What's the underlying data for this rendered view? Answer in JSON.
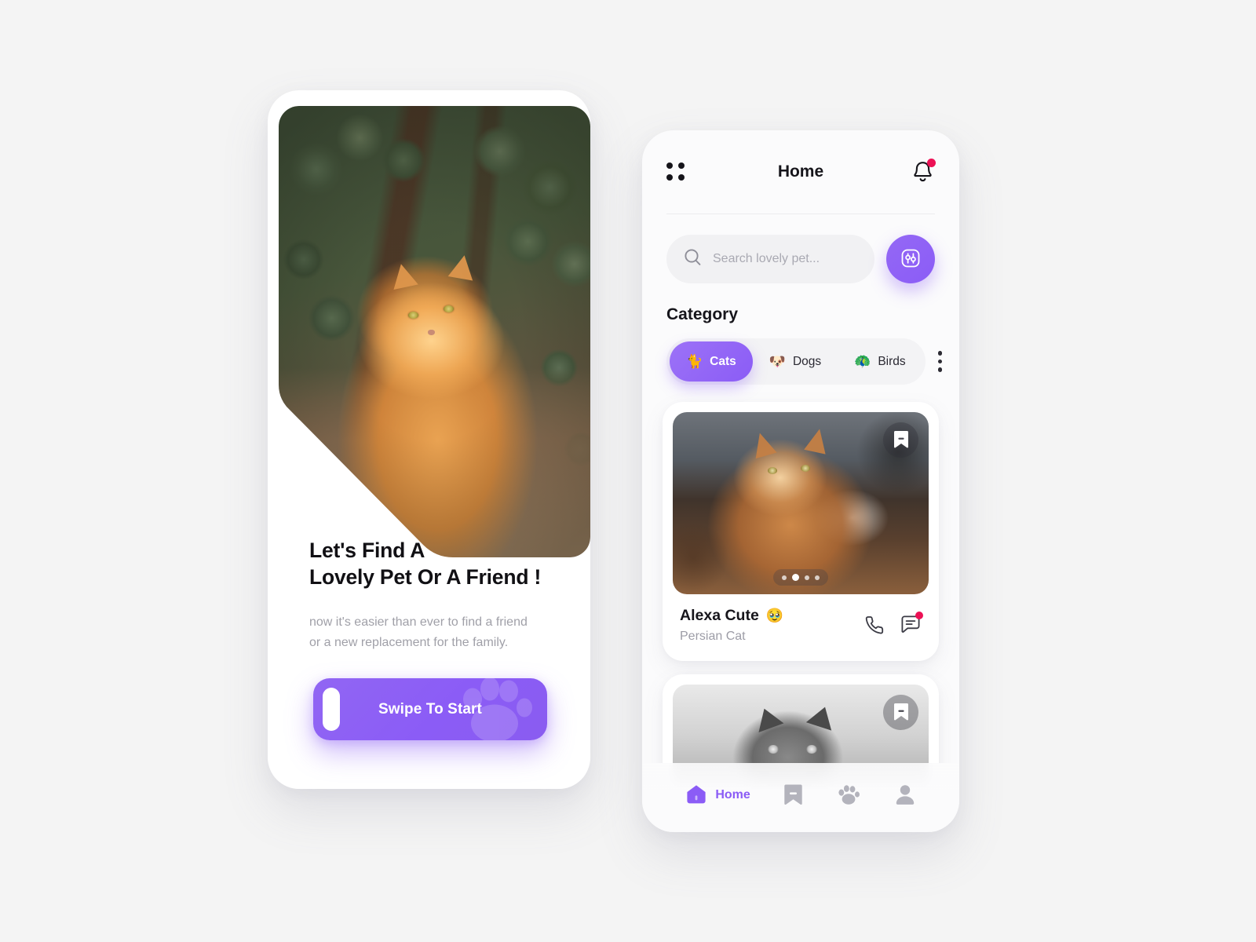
{
  "theme": {
    "accent": "#8b5cf6",
    "accent_light": "#9c72f7",
    "badge": "#ec1155",
    "background": "#f4f4f4",
    "text_dark": "#16151b",
    "text_muted": "#a0a0a8"
  },
  "onboarding": {
    "hero_image_alt": "ginger-long-haired-cat-in-garden",
    "title_line1": "Let's Find A",
    "title_line2": "Lovely Pet Or A Friend !",
    "subtitle_line1": "now it's easier than ever to find a friend",
    "subtitle_line2": "or a new replacement for the family.",
    "swipe_button": {
      "label": "Swipe To Start",
      "handle_icon": "swipe-handle",
      "watermark_icon": "paw-print-icon"
    }
  },
  "app": {
    "header": {
      "menu_icon": "grid-dots-icon",
      "title": "Home",
      "bell_icon": "bell-icon",
      "bell_has_badge": true
    },
    "search": {
      "icon": "search-icon",
      "value": "",
      "placeholder": "Search lovely pet...",
      "filter_icon": "sliders-icon"
    },
    "category": {
      "title": "Category",
      "more_icon": "kebab-menu-icon",
      "chips": [
        {
          "label": "Cats",
          "emoji": "🐈",
          "active": true
        },
        {
          "label": "Dogs",
          "emoji": "🐶",
          "active": false
        },
        {
          "label": "Birds",
          "emoji": "🦚",
          "active": false
        }
      ]
    },
    "cards": [
      {
        "image_alt": "maine-coon-ginger-cat",
        "bookmark_icon": "bookmark-icon",
        "carousel_dots": 4,
        "carousel_active_index": 1,
        "name": "Alexa Cute",
        "name_emoji": "🥹",
        "breed": "Persian Cat",
        "call_icon": "phone-icon",
        "chat_icon": "chat-bubble-icon",
        "chat_has_badge": true
      },
      {
        "image_alt": "grey-british-shorthair-cat-grayscale",
        "bookmark_icon": "bookmark-icon"
      }
    ],
    "bottom_nav": [
      {
        "icon": "home-icon",
        "label": "Home",
        "active": true
      },
      {
        "icon": "bookmark-icon",
        "label": "",
        "active": false
      },
      {
        "icon": "paw-icon",
        "label": "",
        "active": false
      },
      {
        "icon": "person-icon",
        "label": "",
        "active": false
      }
    ]
  }
}
